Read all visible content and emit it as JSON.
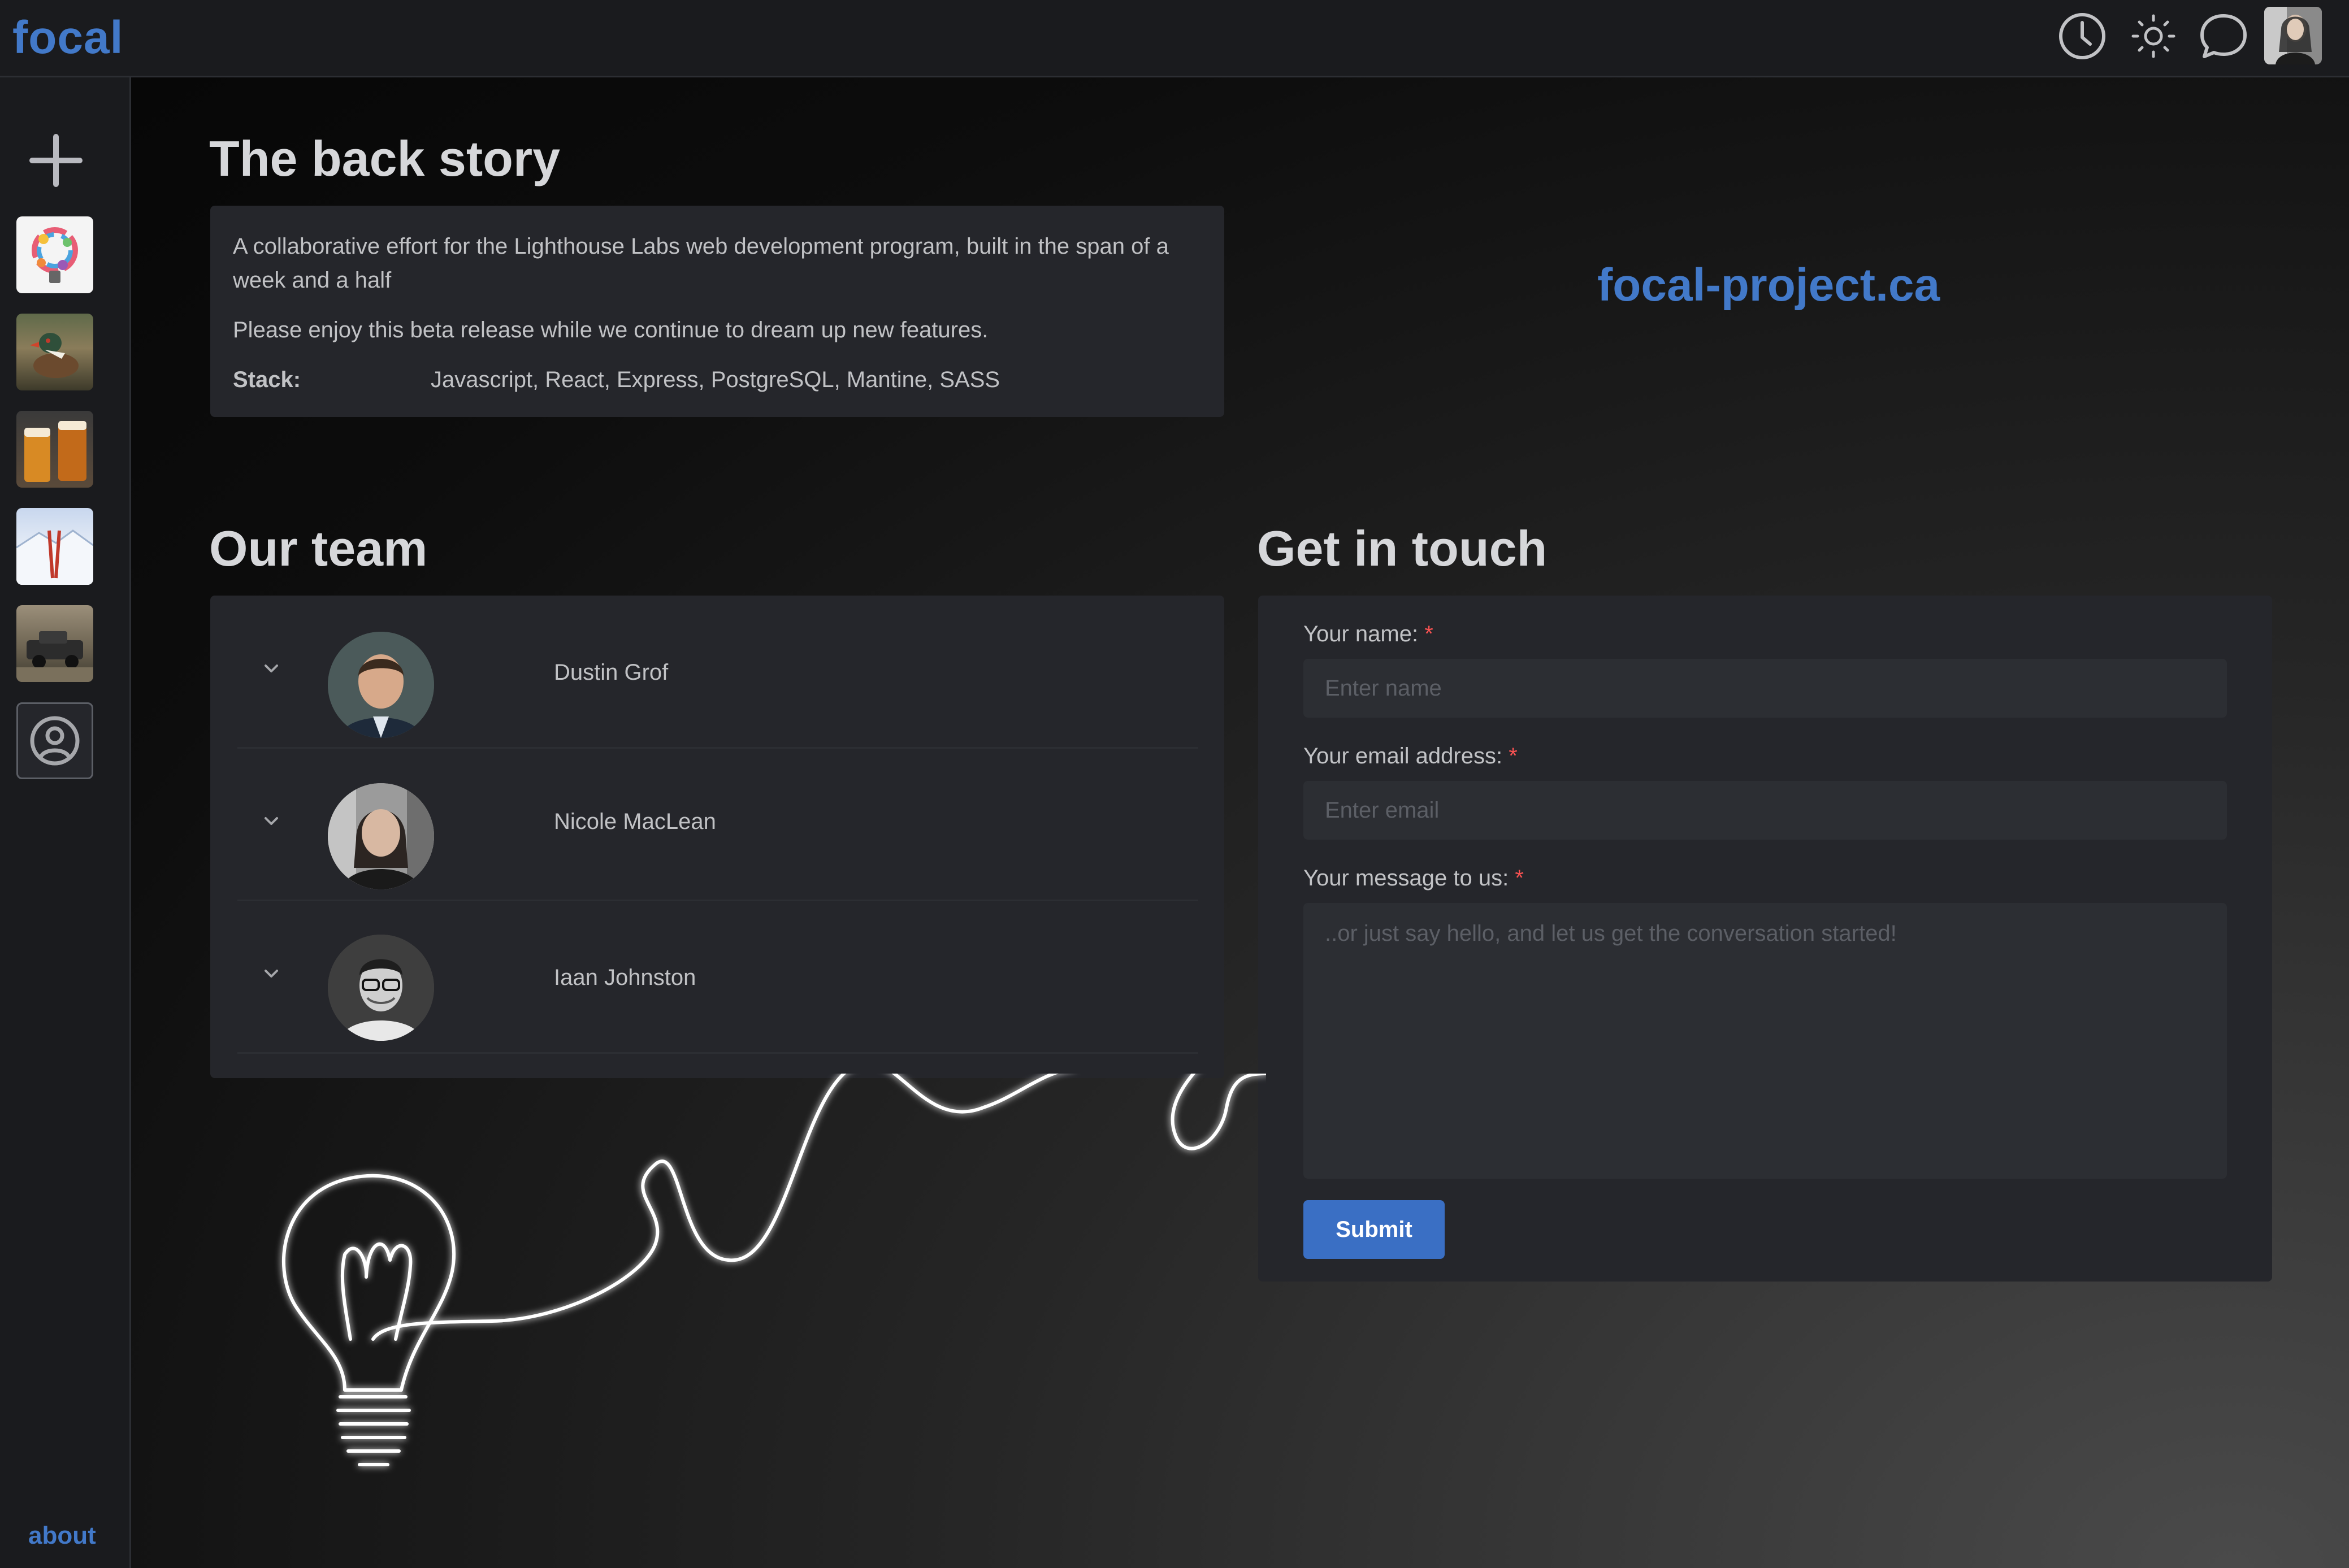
{
  "app": {
    "logo": "focal"
  },
  "header": {
    "icons": [
      "clock-icon",
      "sun-icon",
      "chat-bubble-icon"
    ],
    "avatar": "user-avatar"
  },
  "sidebar": {
    "add_icon": "plus-icon",
    "thumbnails": [
      "colorful-lightbulb-album",
      "duck-album",
      "beer-album",
      "ski-album",
      "truck-album"
    ],
    "profile_icon": "user-circle-icon",
    "about_label": "about"
  },
  "backstory": {
    "title": "The back story",
    "paragraph1": "A collaborative effort for the Lighthouse Labs web development program, built in the span of a week and a half",
    "paragraph2": "Please enjoy this beta release while we continue to dream up new features.",
    "stack_label": "Stack:",
    "stack_value": "Javascript, React, Express, PostgreSQL, Mantine, SASS"
  },
  "site_link": "focal-project.ca",
  "team": {
    "title": "Our team",
    "members": [
      {
        "name": "Dustin Grof"
      },
      {
        "name": "Nicole MacLean"
      },
      {
        "name": "Iaan Johnston"
      }
    ]
  },
  "contact": {
    "title": "Get in touch",
    "name_label": "Your name:",
    "name_placeholder": "Enter name",
    "email_label": "Your email address:",
    "email_placeholder": "Enter email",
    "message_label": "Your message to us:",
    "message_placeholder": "..or just say hello, and let us get the conversation started!",
    "required_mark": "*",
    "submit_label": "Submit"
  },
  "colors": {
    "accent": "#4279c9",
    "button": "#3a6fc4",
    "card": "#25262b",
    "required": "#fa5252"
  }
}
